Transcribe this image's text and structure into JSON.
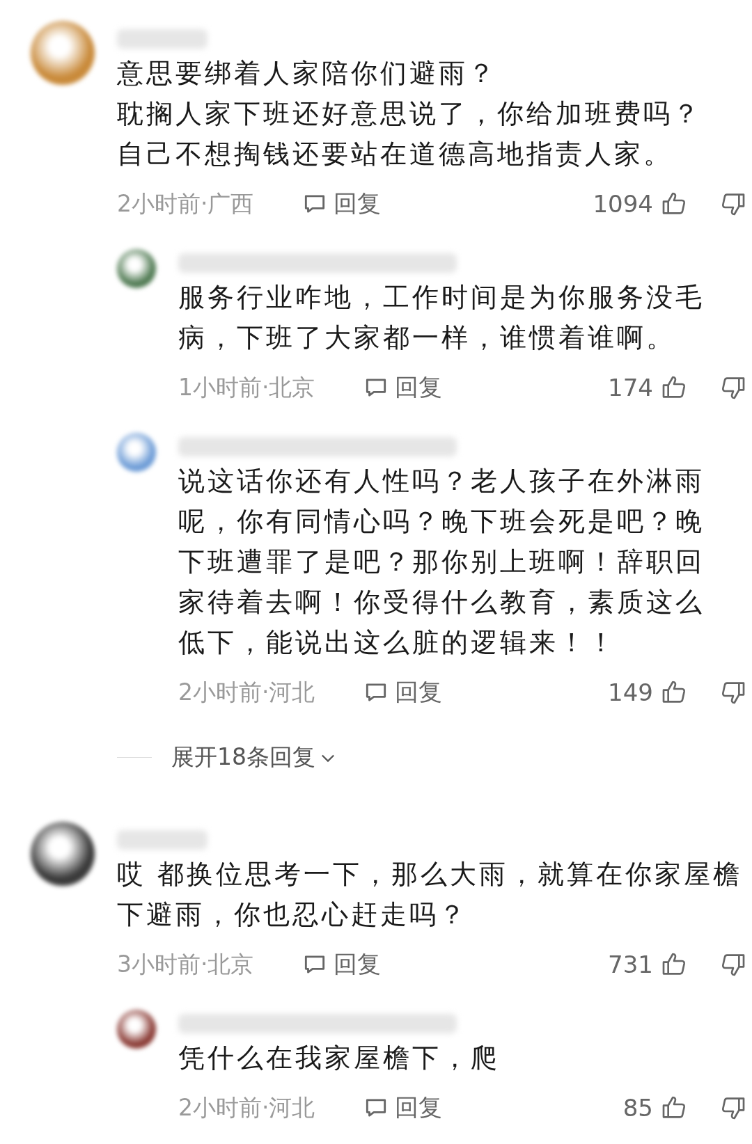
{
  "comments": [
    {
      "text": [
        "意思要绑着人家陪你们避雨？",
        "耽搁人家下班还好意思说了，你给加班费吗？",
        "自己不想掏钱还要站在道德高地指责人家。"
      ],
      "time": "2小时前·广西",
      "reply": "回复",
      "likes": "1094",
      "replies": [
        {
          "text": [
            "服务行业咋地，工作时间是为你服务没毛病，下班了大家都一样，谁惯着谁啊。"
          ],
          "time": "1小时前·北京",
          "reply": "回复",
          "likes": "174"
        },
        {
          "text": [
            "说这话你还有人性吗？老人孩子在外淋雨呢，你有同情心吗？晚下班会死是吧？晚下班遭罪了是吧？那你别上班啊！辞职回家待着去啊！你受得什么教育，素质这么低下，能说出这么脏的逻辑来！！"
          ],
          "time": "2小时前·河北",
          "reply": "回复",
          "likes": "149"
        }
      ],
      "expand": "展开18条回复"
    },
    {
      "text": [
        "哎 都换位思考一下，那么大雨，就算在你家屋檐下避雨，你也忍心赶走吗？"
      ],
      "time": "3小时前·北京",
      "reply": "回复",
      "likes": "731",
      "replies": [
        {
          "text": [
            "凭什么在我家屋檐下，爬"
          ],
          "time": "2小时前·河北",
          "reply": "回复",
          "likes": "85"
        }
      ]
    }
  ]
}
